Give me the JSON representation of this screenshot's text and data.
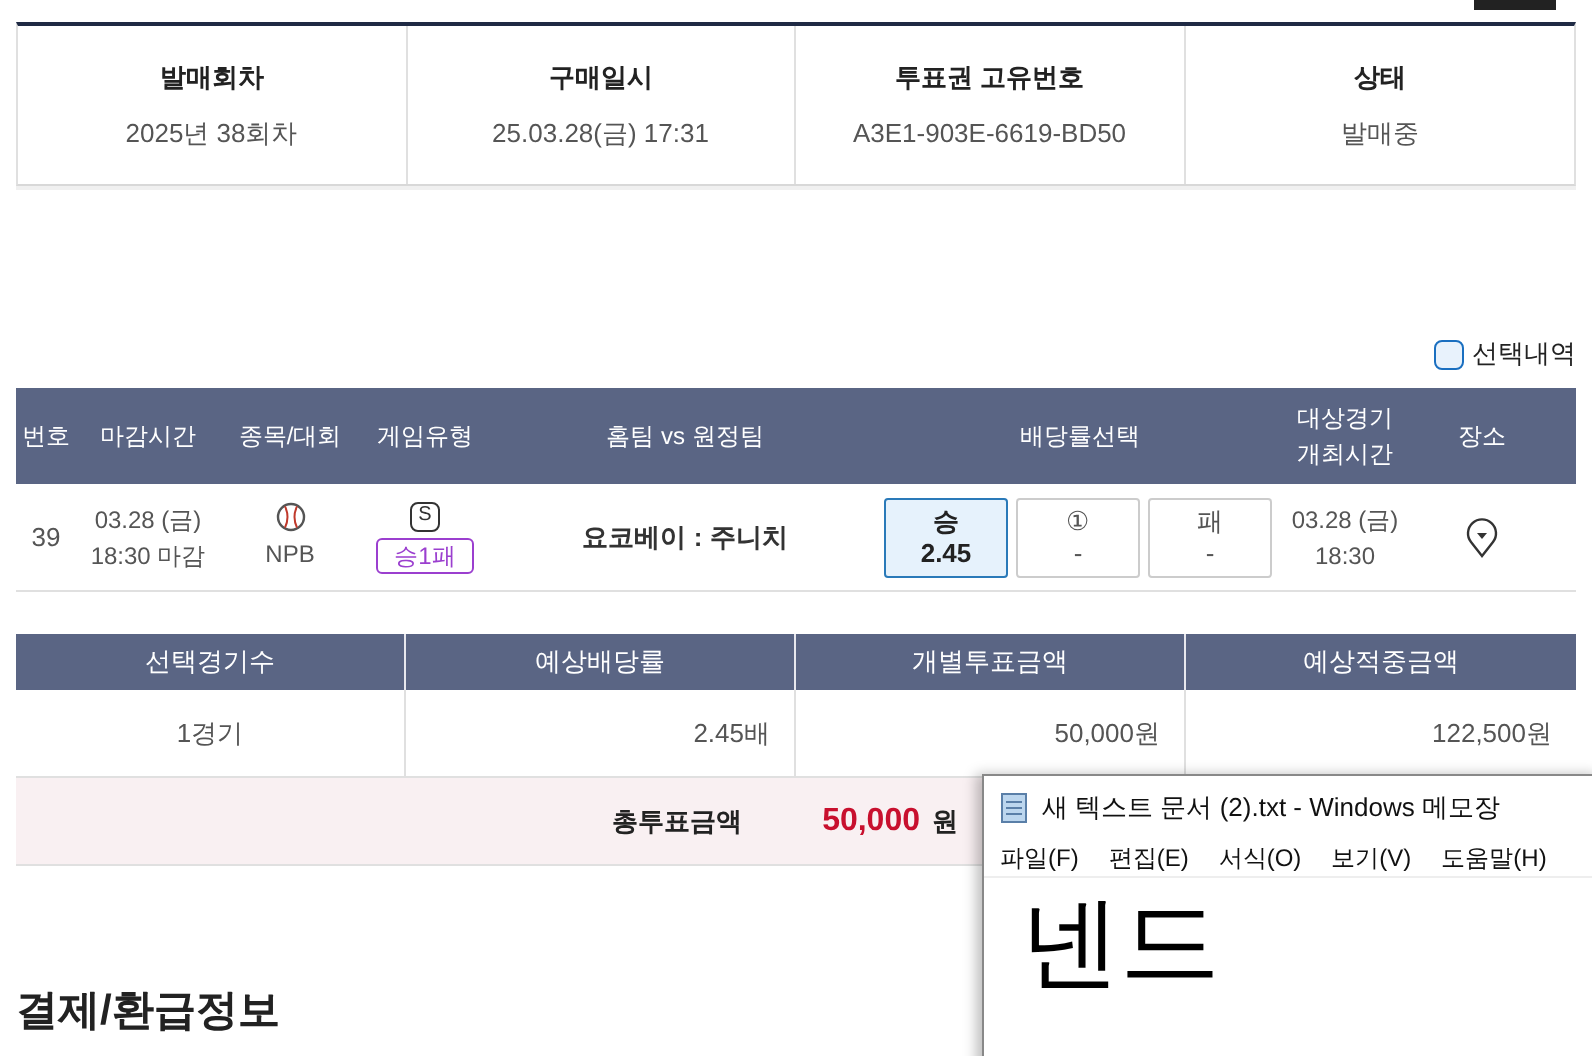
{
  "info_card": {
    "columns": [
      {
        "label": "발매회차",
        "value": "2025년 38회차"
      },
      {
        "label": "구매일시",
        "value": "25.03.28(금) 17:31"
      },
      {
        "label": "투표권 고유번호",
        "value": "A3E1-903E-6619-BD50"
      },
      {
        "label": "상태",
        "value": "발매중"
      }
    ]
  },
  "selection_toggle": {
    "label": "선택내역",
    "checked": false
  },
  "bet_table": {
    "columns": [
      "번호",
      "마감시간",
      "종목/대회",
      "게임유형",
      "홈팀 vs 원정팀",
      "배당률선택",
      "대상경기 개최시간",
      "장소"
    ],
    "rows": [
      {
        "number": "39",
        "deadline_date": "03.28 (금)",
        "deadline_time": "18:30 마감",
        "sport": "NPB",
        "game_type_mark": "S",
        "game_type": "승1패",
        "match": "요코베이 : 주니치",
        "odds": [
          {
            "label": "승",
            "value": "2.45",
            "selected": true
          },
          {
            "label": "①",
            "value": "-",
            "selected": false
          },
          {
            "label": "패",
            "value": "-",
            "selected": false
          }
        ],
        "match_date": "03.28 (금)",
        "match_time": "18:30"
      }
    ]
  },
  "summary_table": {
    "columns": [
      "선택경기수",
      "예상배당률",
      "개별투표금액",
      "예상적중금액"
    ],
    "row": [
      "1경기",
      "2.45배",
      "50,000원",
      "122,500원"
    ],
    "total": {
      "label": "총투표금액",
      "amount": "50,000",
      "unit": "원"
    }
  },
  "section_heading": "결제/환급정보",
  "notepad": {
    "title": "새 텍스트 문서 (2).txt - Windows 메모장",
    "menu": [
      "파일(F)",
      "편집(E)",
      "서식(O)",
      "보기(V)",
      "도움말(H)"
    ],
    "content": "넨드"
  }
}
